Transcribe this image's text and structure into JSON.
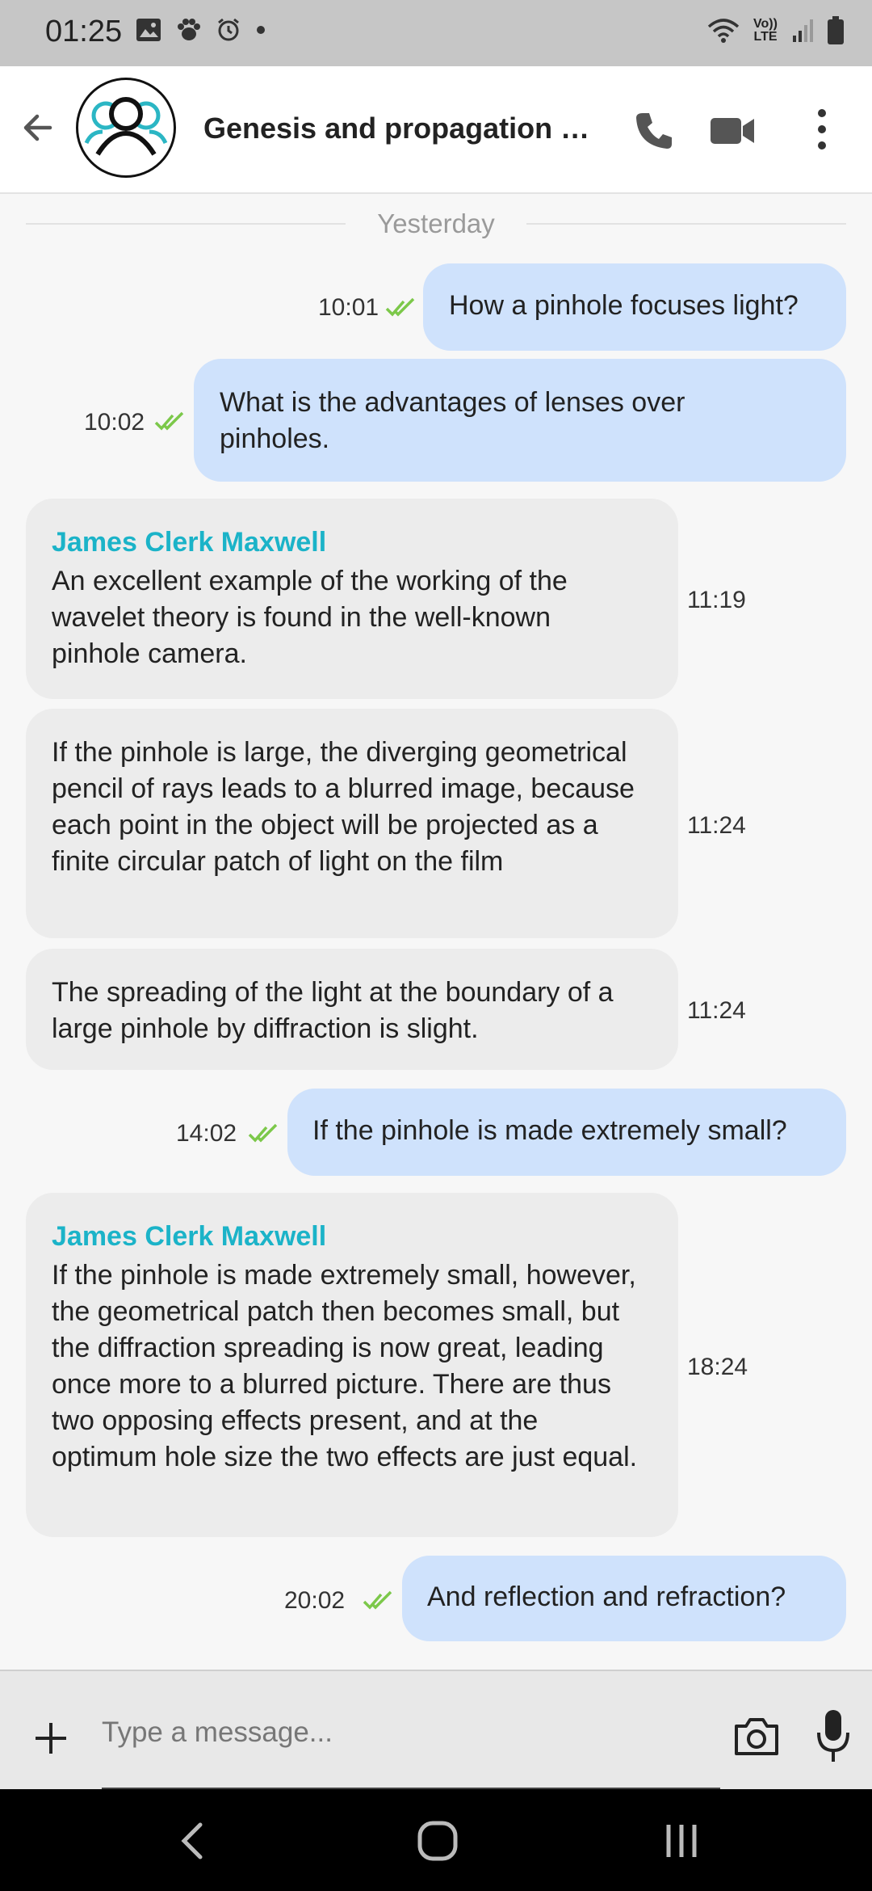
{
  "status_bar": {
    "time": "01:25",
    "network_label": "Vo)) LTE"
  },
  "header": {
    "title": "Genesis and propagation of ..."
  },
  "date_divider": "Yesterday",
  "messages": [
    {
      "direction": "outgoing",
      "time": "10:01",
      "text": "How a pinhole focuses light?"
    },
    {
      "direction": "outgoing",
      "time": "10:02",
      "text": "What is the advantages of lenses over pinholes."
    },
    {
      "direction": "incoming",
      "sender": "James Clerk Maxwell",
      "time": "11:19",
      "text": "An excellent example of the working of the wavelet theory is found in the well-known pinhole camera."
    },
    {
      "direction": "incoming",
      "time": "11:24",
      "text": "If the pinhole is large, the diverging geometrical pencil of rays leads to a blurred image, because each point in the object will be projected as a finite circular patch of light on the film"
    },
    {
      "direction": "incoming",
      "time": "11:24",
      "text": "The spreading of the light at the boundary of a large pinhole by diffraction is slight."
    },
    {
      "direction": "outgoing",
      "time": "14:02",
      "text": "If the pinhole is made extremely small?"
    },
    {
      "direction": "incoming",
      "sender": "James Clerk Maxwell",
      "time": "18:24",
      "text": "If the pinhole is made extremely small, however, the geometrical patch then becomes small, but the diffraction spreading is now great, leading once more to a blurred picture. There are thus two opposing effects present, and at the optimum hole size the two effects are just equal."
    },
    {
      "direction": "outgoing",
      "time": "20:02",
      "text": "And reflection and refraction?"
    }
  ],
  "composer": {
    "placeholder": "Type a message..."
  },
  "colors": {
    "outgoing_bubble": "#cfe2fc",
    "incoming_bubble": "#ececec",
    "sender_name": "#1bb3c8",
    "read_check": "#7cc84a"
  },
  "icons": [
    "back-arrow-icon",
    "group-avatar-icon",
    "phone-icon",
    "video-camera-icon",
    "more-vert-icon",
    "plus-icon",
    "camera-icon",
    "microphone-icon"
  ]
}
